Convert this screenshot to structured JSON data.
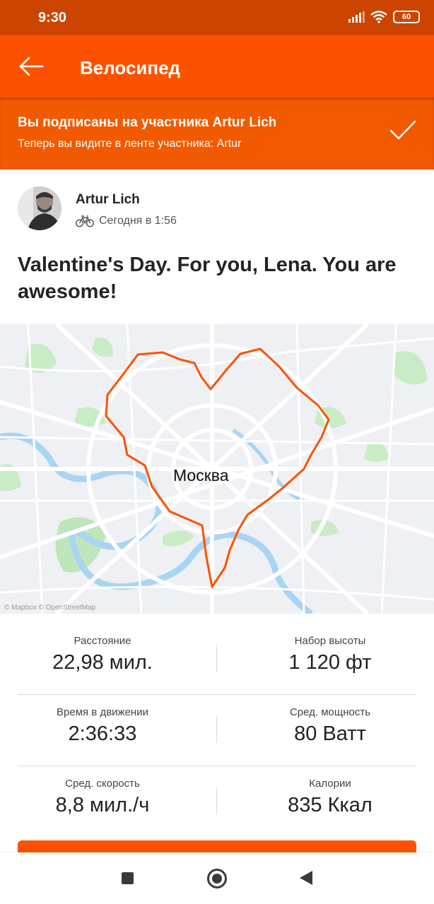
{
  "status_bar": {
    "time": "9:30",
    "battery": "60",
    "icons": [
      "signal-icon",
      "wifi-icon",
      "battery-icon"
    ]
  },
  "app_bar": {
    "title": "Велосипед",
    "back_icon": "arrow-left-icon",
    "color": "#fc5200"
  },
  "follow_banner": {
    "title": "Вы подписаны на участника Artur Lich",
    "subtitle": "Теперь вы видите в ленте участника: Artur",
    "icon": "check-icon"
  },
  "activity": {
    "athlete_name": "Artur Lich",
    "sport_icon": "bicycle-icon",
    "date": "Сегодня в 1:56",
    "title": "Valentine's Day. For you, Lena. You are awesome!"
  },
  "map": {
    "city_label": "Москва",
    "attribution": "© Mapbox © OpenStreetMap",
    "route_color": "#fc5200"
  },
  "stats": [
    {
      "left": {
        "label": "Расстояние",
        "value": "22,98 мил."
      },
      "right": {
        "label": "Набор высоты",
        "value": "1 120 фт"
      }
    },
    {
      "left": {
        "label": "Время в движении",
        "value": "2:36:33"
      },
      "right": {
        "label": "Сред. мощность",
        "value": "80 Ватт"
      }
    },
    {
      "left": {
        "label": "Сред. скорость",
        "value": "8,8 мил./ч"
      },
      "right": {
        "label": "Калории",
        "value": "835 Ккал"
      }
    }
  ],
  "nav_bar": {
    "icons": [
      "recents-square-icon",
      "home-circle-icon",
      "back-triangle-icon"
    ]
  }
}
